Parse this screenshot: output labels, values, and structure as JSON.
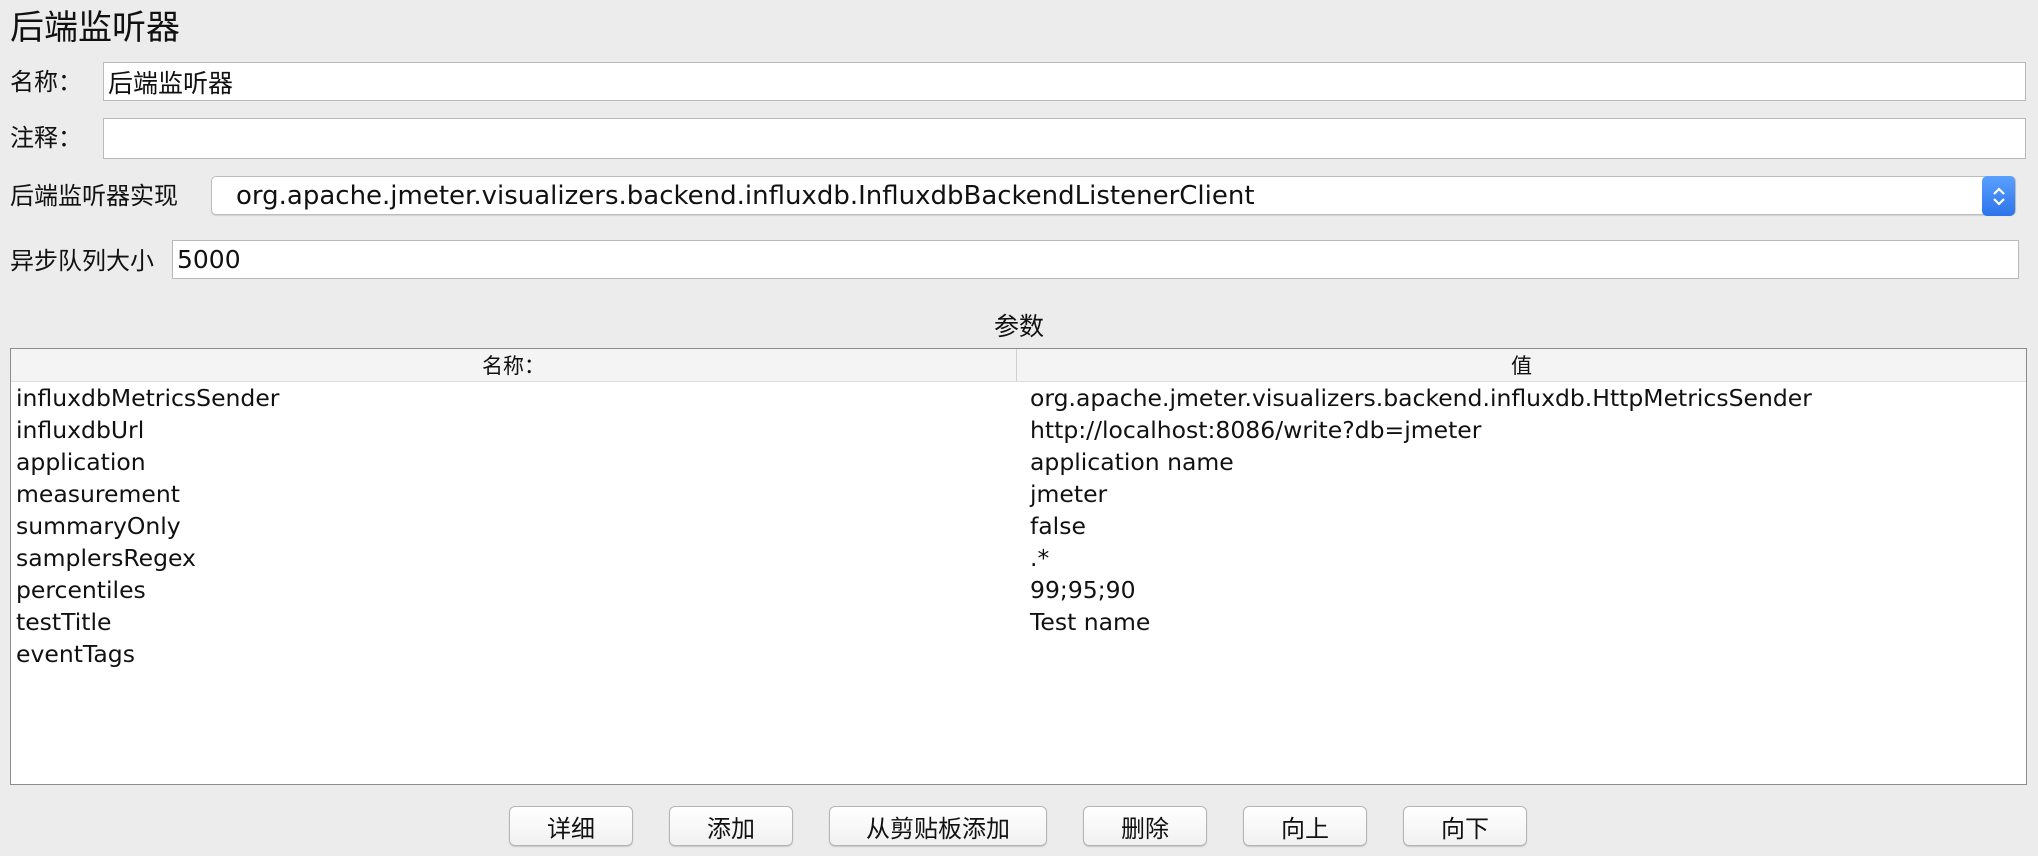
{
  "header": {
    "title": "后端监听器"
  },
  "form": {
    "name_label": "名称：",
    "name_value": "后端监听器",
    "comment_label": "注释：",
    "comment_value": "",
    "impl_label": "后端监听器实现",
    "impl_value": "org.apache.jmeter.visualizers.backend.influxdb.InfluxdbBackendListenerClient",
    "queue_label": "异步队列大小",
    "queue_value": "5000"
  },
  "params": {
    "title": "参数",
    "columns": [
      "名称：",
      "值"
    ],
    "rows": [
      [
        "influxdbMetricsSender",
        "org.apache.jmeter.visualizers.backend.influxdb.HttpMetricsSender"
      ],
      [
        "influxdbUrl",
        "http://localhost:8086/write?db=jmeter"
      ],
      [
        "application",
        "application name"
      ],
      [
        "measurement",
        "jmeter"
      ],
      [
        "summaryOnly",
        "false"
      ],
      [
        "samplersRegex",
        ".*"
      ],
      [
        "percentiles",
        "99;95;90"
      ],
      [
        "testTitle",
        "Test name"
      ],
      [
        "eventTags",
        ""
      ]
    ]
  },
  "buttons": {
    "detail": "详细",
    "add": "添加",
    "add_clipboard": "从剪贴板添加",
    "delete": "删除",
    "up": "向上",
    "down": "向下"
  },
  "colors": {
    "background": "#ececec",
    "accent": "#2d74ea"
  }
}
